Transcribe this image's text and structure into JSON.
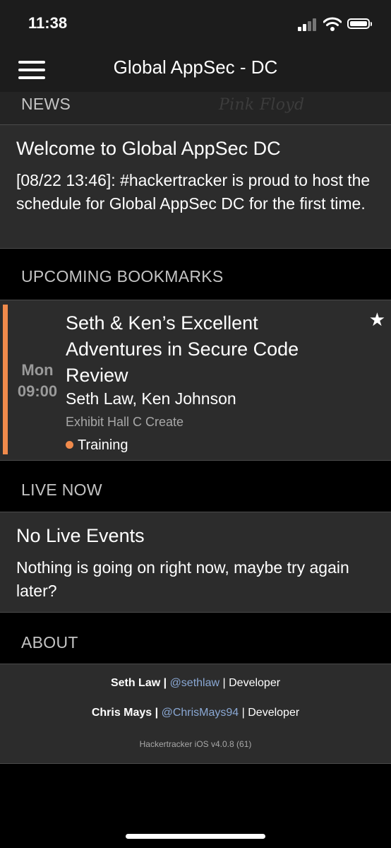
{
  "status_bar": {
    "time": "11:38",
    "icons": [
      "signal-icon",
      "wifi-icon",
      "battery-icon"
    ]
  },
  "nav": {
    "title": "Global AppSec - DC",
    "menu_icon": "hamburger-menu-icon"
  },
  "news": {
    "header": "NEWS",
    "title": "Welcome to Global AppSec DC",
    "body": "[08/22 13:46]: #hackertracker is proud to host the schedule for Global AppSec DC for the first time."
  },
  "bookmarks": {
    "header": "UPCOMING BOOKMARKS",
    "event": {
      "day": "Mon",
      "time": "09:00",
      "title": "Seth & Ken’s Excellent Adventures in Secure Code Review",
      "speakers": "Seth Law, Ken Johnson",
      "location": "Exhibit Hall C Create",
      "type": "Training",
      "type_color": "#f08a4b",
      "bookmarked_icon": "star-icon"
    }
  },
  "live": {
    "header": "LIVE NOW",
    "title": "No Live Events",
    "body": "Nothing is going on right now, maybe try again later?"
  },
  "about": {
    "header": "ABOUT",
    "developers": [
      {
        "name": "Seth Law",
        "separator": "|",
        "handle": "@sethlaw",
        "role": "Developer"
      },
      {
        "name": "Chris Mays",
        "separator": "|",
        "handle": "@ChrisMays94",
        "role": "Developer"
      }
    ],
    "version": "Hackertracker iOS v4.0.8 (61)"
  },
  "colors": {
    "accent": "#f08a4b",
    "link": "#8aa8d4",
    "card": "#2c2c2c",
    "background": "#000000"
  }
}
